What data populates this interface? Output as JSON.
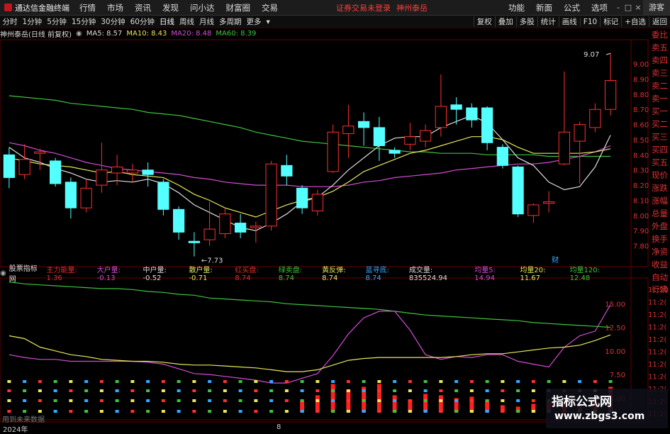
{
  "app": {
    "title": "通达信金融终端",
    "menu": [
      "行情",
      "市场",
      "资讯",
      "发现",
      "问小达",
      "财富圈",
      "交易"
    ],
    "alert": "证券交易未登录",
    "stock_name": "神州泰岳",
    "right_menu": [
      "功能",
      "新面",
      "公式",
      "选项"
    ],
    "window_controls": [
      "-",
      "□",
      "×"
    ],
    "guest": "游客"
  },
  "toolbar": {
    "timeframes": [
      "分时",
      "1分钟",
      "5分钟",
      "15分钟",
      "30分钟",
      "60分钟",
      "日线",
      "周线",
      "月线",
      "多周期",
      "更多"
    ],
    "active": "日线",
    "right_buttons": [
      "复权",
      "叠加",
      "多股",
      "统计",
      "画线",
      "F10",
      "标记",
      "+自选",
      "返回"
    ]
  },
  "kline_legend": {
    "title": "神州泰岳(日线 前复权)",
    "ma": [
      {
        "label": "MA5: 8.57",
        "color": "#dddddd"
      },
      {
        "label": "MA10: 8.43",
        "color": "#e8e85a"
      },
      {
        "label": "MA20: 8.48",
        "color": "#d34dd3"
      },
      {
        "label": "MA60: 8.39",
        "color": "#3fc33f"
      }
    ]
  },
  "price_axis": [
    "9.00",
    "8.90",
    "8.80",
    "8.70",
    "8.60",
    "8.50",
    "8.40",
    "8.30",
    "8.20",
    "8.10",
    "8.00",
    "7.90",
    "7.80"
  ],
  "annotations": {
    "high": "9.07",
    "low": "7.73",
    "fin_mark": "财"
  },
  "side_panel": [
    "委比",
    "卖五",
    "卖四",
    "卖三",
    "卖二",
    "卖一",
    "买一",
    "买二",
    "买三",
    "买四",
    "买五",
    "现价",
    "涨跌",
    "涨幅",
    "总量",
    "外盘",
    "换手",
    "净资",
    "收益"
  ],
  "side_panel_lower": [
    "自动",
    "行情"
  ],
  "lower_axis": [
    "15.00",
    "12.50",
    "10.00",
    "7.50",
    "5.00"
  ],
  "lower_axis_right": [
    "11:20",
    "11:2(",
    "11:2(",
    "11:2(",
    "11:2(",
    "11:2(",
    "11:2(",
    "11:2(",
    "11:2(",
    "11:2(",
    "11:2("
  ],
  "indicator_legend": {
    "title": "股票指标网",
    "items": [
      {
        "label": "主力能量: 1.36",
        "color": "#e03030"
      },
      {
        "label": "大户量: -0.13",
        "color": "#d34dd3"
      },
      {
        "label": "中户量: -0.52",
        "color": "#dddddd"
      },
      {
        "label": "散户量: -0.71",
        "color": "#e8e85a"
      },
      {
        "label": "红买盘: 8.74",
        "color": "#e03030"
      },
      {
        "label": "绿卖盘: 8.74",
        "color": "#3fc33f"
      },
      {
        "label": "黄反弹: 8.74",
        "color": "#e8e85a"
      },
      {
        "label": "蓝寻底: 8.74",
        "color": "#33aaff"
      },
      {
        "label": "成交量: 835524.94",
        "color": "#dddddd"
      },
      {
        "label": "均量5: 14.94",
        "color": "#d34dd3"
      },
      {
        "label": "均量20: 11.67",
        "color": "#e8e85a"
      },
      {
        "label": "均量120: 12.48",
        "color": "#3fc33f"
      }
    ]
  },
  "footer": {
    "note": "用到未来数据",
    "year": "2024年",
    "month_mark": "8"
  },
  "watermark": {
    "title": "指标公式网",
    "url": "www.zbgs3.com"
  },
  "chart_data": {
    "type": "candlestick",
    "price_ylim": [
      7.7,
      9.15
    ],
    "candles": [
      {
        "o": 8.4,
        "c": 8.25,
        "h": 8.45,
        "l": 8.18
      },
      {
        "o": 8.27,
        "c": 8.37,
        "h": 8.47,
        "l": 8.24
      },
      {
        "o": 8.41,
        "c": 8.42,
        "h": 8.44,
        "l": 8.3
      },
      {
        "o": 8.36,
        "c": 8.21,
        "h": 8.38,
        "l": 8.19
      },
      {
        "o": 8.22,
        "c": 8.05,
        "h": 8.25,
        "l": 7.98
      },
      {
        "o": 8.05,
        "c": 8.18,
        "h": 8.24,
        "l": 8.02
      },
      {
        "o": 8.2,
        "c": 8.3,
        "h": 8.48,
        "l": 8.15
      },
      {
        "o": 8.28,
        "c": 8.32,
        "h": 8.4,
        "l": 8.2
      },
      {
        "o": 8.28,
        "c": 8.3,
        "h": 8.34,
        "l": 8.22
      },
      {
        "o": 8.3,
        "c": 8.27,
        "h": 8.35,
        "l": 8.19
      },
      {
        "o": 8.22,
        "c": 8.04,
        "h": 8.24,
        "l": 8.0
      },
      {
        "o": 8.04,
        "c": 7.89,
        "h": 8.06,
        "l": 7.84
      },
      {
        "o": 7.83,
        "c": 7.82,
        "h": 7.89,
        "l": 7.73
      },
      {
        "o": 7.84,
        "c": 7.91,
        "h": 8.09,
        "l": 7.8
      },
      {
        "o": 7.88,
        "c": 8.01,
        "h": 8.05,
        "l": 7.85
      },
      {
        "o": 7.95,
        "c": 7.89,
        "h": 8.01,
        "l": 7.85
      },
      {
        "o": 7.92,
        "c": 7.93,
        "h": 7.96,
        "l": 7.82
      },
      {
        "o": 7.93,
        "c": 8.34,
        "h": 8.36,
        "l": 7.9
      },
      {
        "o": 8.33,
        "c": 8.26,
        "h": 8.4,
        "l": 8.2
      },
      {
        "o": 8.18,
        "c": 8.05,
        "h": 8.2,
        "l": 8.01
      },
      {
        "o": 8.03,
        "c": 8.14,
        "h": 8.17,
        "l": 8.0
      },
      {
        "o": 8.29,
        "c": 8.55,
        "h": 8.6,
        "l": 8.28
      },
      {
        "o": 8.54,
        "c": 8.59,
        "h": 8.73,
        "l": 8.38
      },
      {
        "o": 8.62,
        "c": 8.58,
        "h": 8.68,
        "l": 8.46
      },
      {
        "o": 8.58,
        "c": 8.46,
        "h": 8.65,
        "l": 8.36
      },
      {
        "o": 8.43,
        "c": 8.41,
        "h": 8.45,
        "l": 8.38
      },
      {
        "o": 8.47,
        "c": 8.52,
        "h": 8.61,
        "l": 8.43
      },
      {
        "o": 8.49,
        "c": 8.56,
        "h": 8.6,
        "l": 8.45
      },
      {
        "o": 8.58,
        "c": 8.72,
        "h": 8.93,
        "l": 8.52
      },
      {
        "o": 8.73,
        "c": 8.7,
        "h": 8.78,
        "l": 8.6
      },
      {
        "o": 8.71,
        "c": 8.63,
        "h": 8.74,
        "l": 8.58
      },
      {
        "o": 8.71,
        "c": 8.48,
        "h": 8.72,
        "l": 8.43
      },
      {
        "o": 8.45,
        "c": 8.33,
        "h": 8.47,
        "l": 8.31
      },
      {
        "o": 8.32,
        "c": 8.01,
        "h": 8.33,
        "l": 7.99
      },
      {
        "o": 8.0,
        "c": 8.07,
        "h": 8.08,
        "l": 7.95
      },
      {
        "o": 8.08,
        "c": 8.09,
        "h": 8.16,
        "l": 8.02
      },
      {
        "o": 8.34,
        "c": 8.55,
        "h": 8.95,
        "l": 8.33
      },
      {
        "o": 8.49,
        "c": 8.6,
        "h": 8.62,
        "l": 8.21
      },
      {
        "o": 8.58,
        "c": 8.7,
        "h": 8.74,
        "l": 8.55
      },
      {
        "o": 8.7,
        "c": 8.89,
        "h": 9.07,
        "l": 8.66
      }
    ],
    "ma5": [
      8.45,
      8.38,
      8.35,
      8.31,
      8.28,
      8.24,
      8.22,
      8.23,
      8.22,
      8.24,
      8.21,
      8.15,
      8.07,
      8.02,
      7.97,
      7.92,
      7.9,
      7.95,
      8.01,
      8.09,
      8.12,
      8.2,
      8.3,
      8.38,
      8.46,
      8.51,
      8.52,
      8.52,
      8.58,
      8.62,
      8.66,
      8.61,
      8.5,
      8.38,
      8.33,
      8.22,
      8.17,
      8.19,
      8.32,
      8.53
    ],
    "ma10": [
      8.38,
      8.36,
      8.34,
      8.33,
      8.32,
      8.3,
      8.28,
      8.29,
      8.27,
      8.26,
      8.25,
      8.2,
      8.14,
      8.1,
      8.05,
      8.02,
      7.99,
      8.03,
      8.07,
      8.1,
      8.12,
      8.16,
      8.22,
      8.29,
      8.33,
      8.37,
      8.41,
      8.43,
      8.46,
      8.49,
      8.52,
      8.52,
      8.5,
      8.45,
      8.41,
      8.41,
      8.41,
      8.41,
      8.42,
      8.44
    ],
    "ma20": [
      8.48,
      8.46,
      8.43,
      8.41,
      8.38,
      8.35,
      8.33,
      8.31,
      8.3,
      8.29,
      8.28,
      8.27,
      8.25,
      8.24,
      8.22,
      8.21,
      8.2,
      8.2,
      8.2,
      8.19,
      8.19,
      8.19,
      8.2,
      8.22,
      8.23,
      8.25,
      8.26,
      8.27,
      8.28,
      8.3,
      8.31,
      8.32,
      8.33,
      8.34,
      8.34,
      8.35,
      8.37,
      8.39,
      8.42,
      8.46
    ],
    "ma60": [
      8.79,
      8.78,
      8.77,
      8.76,
      8.74,
      8.73,
      8.72,
      8.71,
      8.7,
      8.68,
      8.67,
      8.66,
      8.64,
      8.62,
      8.6,
      8.58,
      8.55,
      8.53,
      8.51,
      8.49,
      8.48,
      8.47,
      8.46,
      8.45,
      8.44,
      8.43,
      8.42,
      8.42,
      8.41,
      8.41,
      8.41,
      8.4,
      8.4,
      8.4,
      8.4,
      8.39,
      8.39,
      8.39,
      8.39,
      8.39
    ],
    "lower_ylim": [
      3.0,
      17.5
    ],
    "jl5": [
      9.6,
      9.3,
      9.1,
      9.1,
      8.9,
      8.9,
      8.9,
      8.9,
      8.9,
      8.8,
      8.6,
      8.1,
      7.6,
      7.5,
      7.3,
      7.1,
      6.9,
      6.6,
      6.6,
      7.1,
      7.6,
      9.5,
      11.8,
      13.5,
      14.2,
      14.2,
      12.2,
      9.6,
      9.1,
      9.4,
      9.3,
      9.6,
      9.6,
      8.9,
      8.6,
      8.3,
      10.4,
      11.6,
      12.1,
      14.9
    ],
    "jl20": [
      11.6,
      11.3,
      10.4,
      10.0,
      9.6,
      9.4,
      9.1,
      9.0,
      8.9,
      8.9,
      8.8,
      8.6,
      8.5,
      8.5,
      8.4,
      8.3,
      8.2,
      8.0,
      7.8,
      7.8,
      8.0,
      8.5,
      9.0,
      9.2,
      9.3,
      9.3,
      9.3,
      9.3,
      9.3,
      9.4,
      9.6,
      9.7,
      9.7,
      9.9,
      10.1,
      10.3,
      10.4,
      10.6,
      11.1,
      11.7
    ],
    "jl120": [
      17.3,
      17.1,
      17.0,
      16.9,
      16.8,
      16.7,
      16.6,
      16.6,
      16.5,
      16.3,
      16.2,
      16.0,
      15.9,
      15.6,
      15.5,
      15.4,
      15.3,
      15.2,
      15.0,
      14.9,
      14.8,
      14.7,
      14.6,
      14.5,
      14.4,
      14.2,
      14.0,
      13.8,
      13.7,
      13.6,
      13.5,
      13.4,
      13.3,
      13.2,
      13.0,
      12.9,
      12.8,
      12.7,
      12.6,
      12.5
    ],
    "main_force": [
      0,
      0,
      0,
      0,
      0,
      0,
      0,
      0,
      0,
      0,
      0,
      0,
      0,
      0,
      0,
      0,
      0,
      0,
      0,
      0.8,
      1.2,
      2.0,
      1.6,
      1.8,
      2.0,
      1.2,
      0.9,
      1.3,
      1.2,
      1.0,
      1.1,
      0.8,
      0.5,
      0.4,
      0.6,
      0.8,
      0.6,
      0.9,
      1.1,
      1.8
    ]
  }
}
